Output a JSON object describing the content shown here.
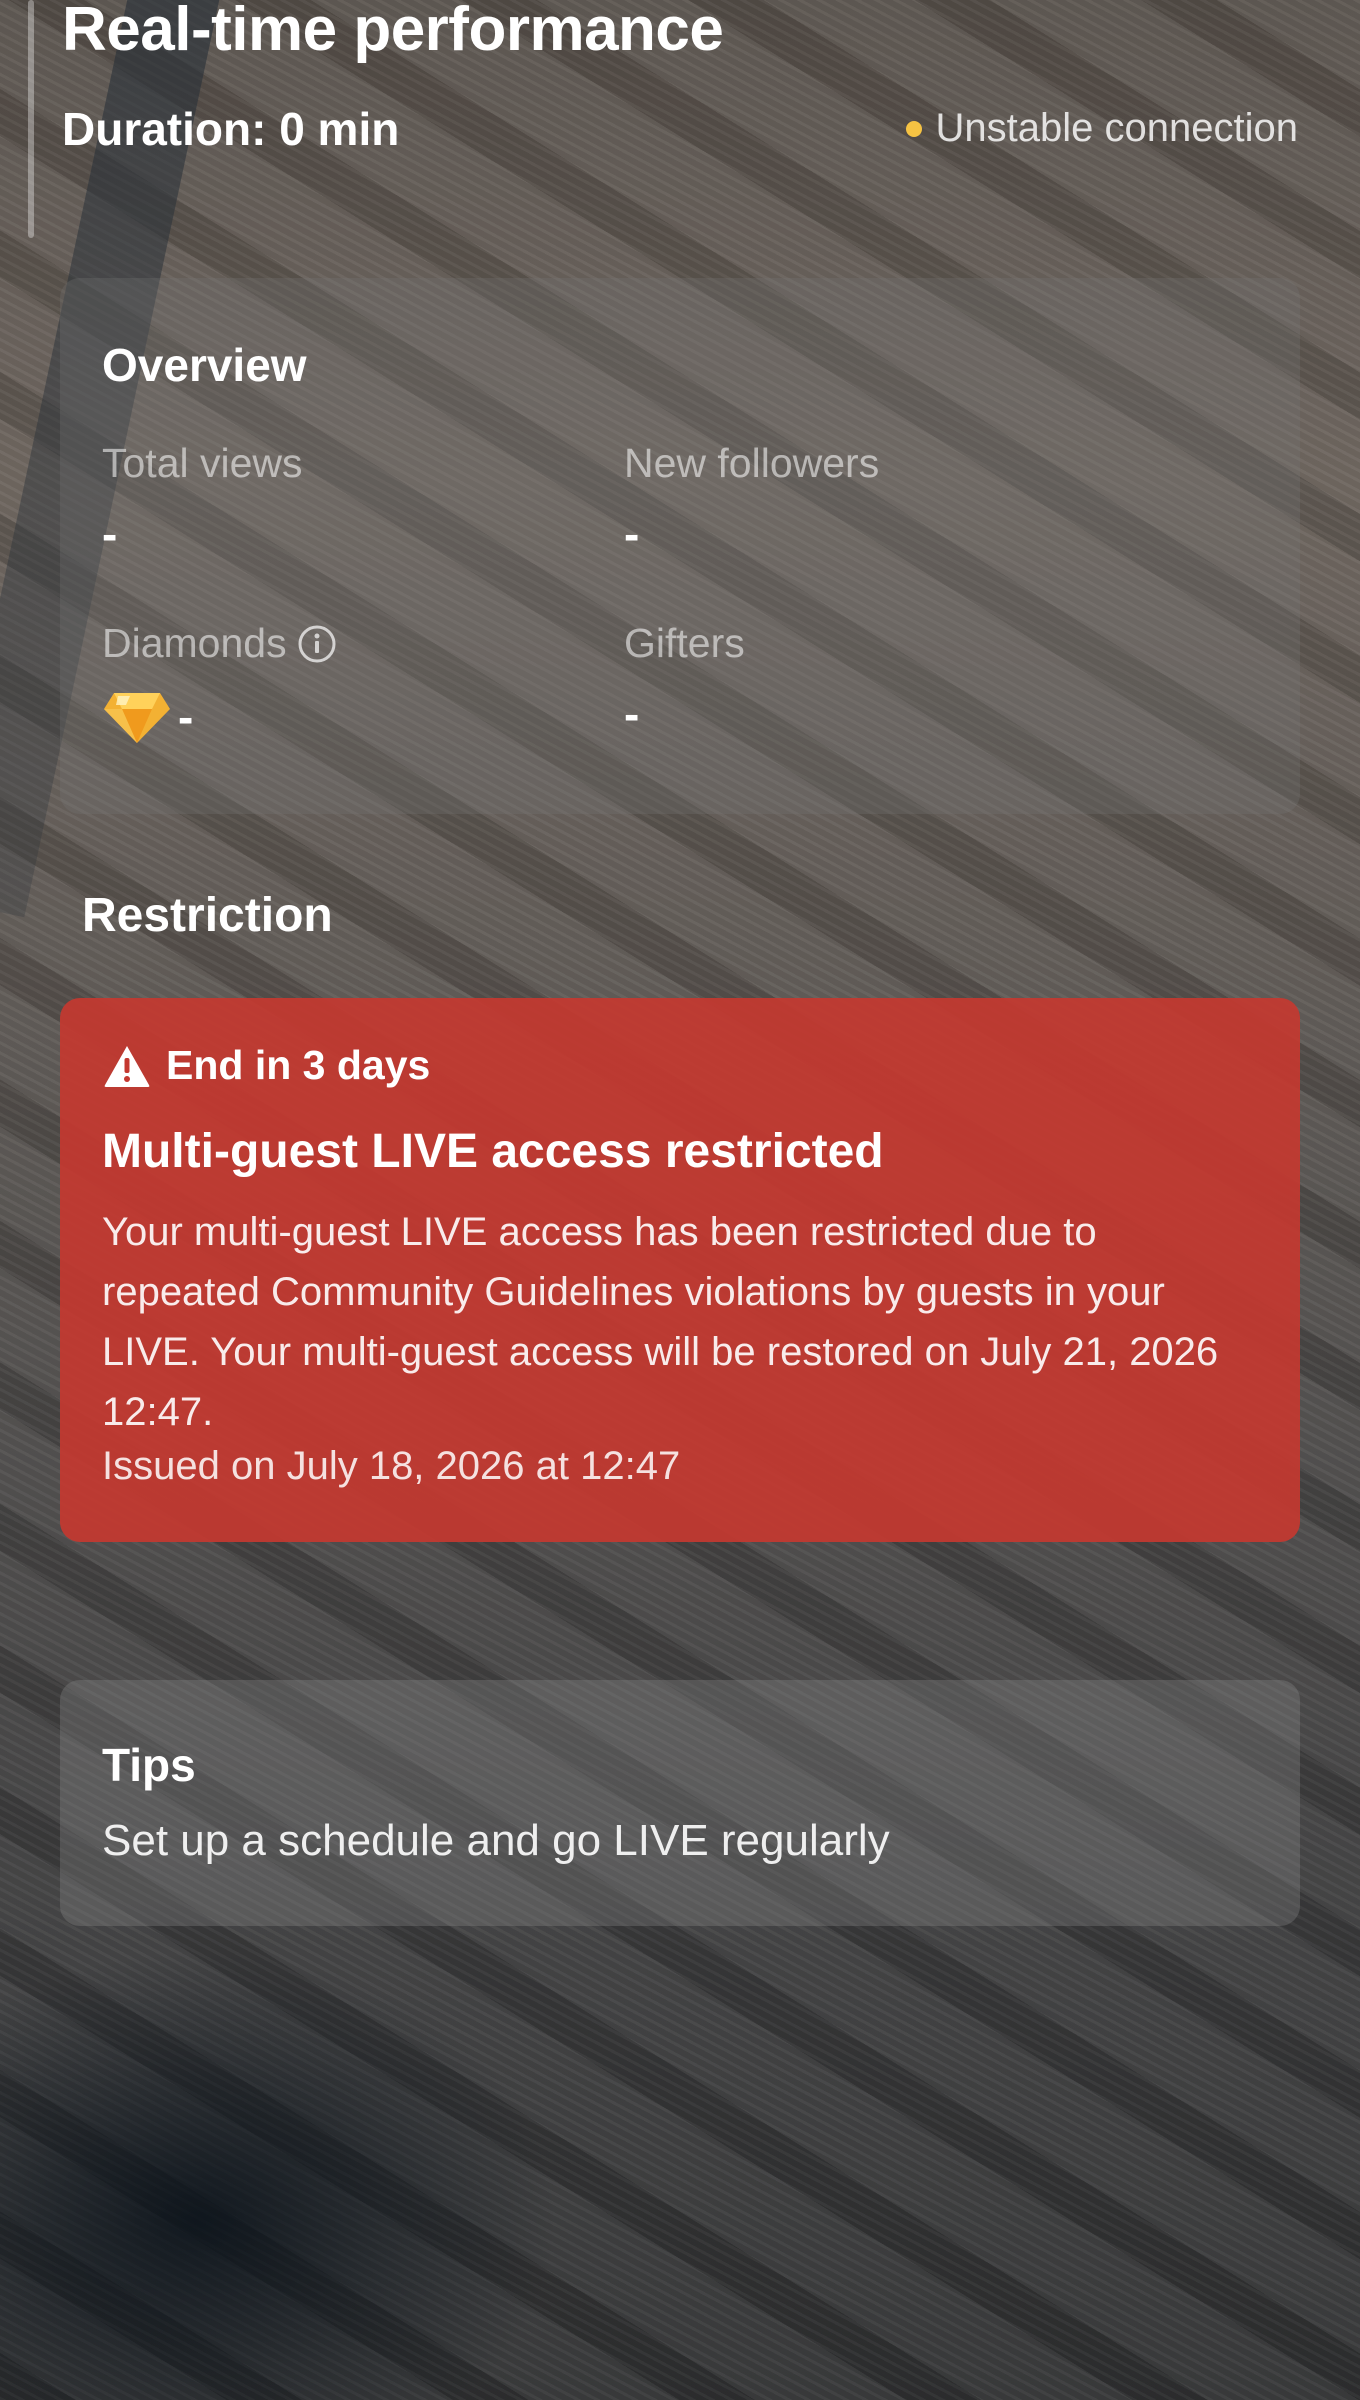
{
  "header": {
    "title": "Real-time performance",
    "duration": "Duration: 0 min",
    "connection_status": "Unstable connection",
    "connection_status_color": "#f6c343"
  },
  "overview": {
    "heading": "Overview",
    "metrics": [
      {
        "label": "Total views",
        "value": "-"
      },
      {
        "label": "New followers",
        "value": "-"
      },
      {
        "label": "Diamonds",
        "value": "-",
        "icon": "diamond-icon",
        "info_icon": "info-icon"
      },
      {
        "label": "Gifters",
        "value": "-"
      }
    ]
  },
  "restriction": {
    "section_title": "Restriction",
    "badge_icon": "warning-icon",
    "badge_text": "End in 3 days",
    "title": "Multi-guest LIVE access restricted",
    "body": "Your multi-guest LIVE access has been restricted due to repeated Community Guidelines violations by guests in your LIVE. Your multi-guest access will be restored on July 21, 2026 12:47.",
    "issued": "Issued on July 18, 2026 at 12:47",
    "card_color": "#c43830"
  },
  "tips": {
    "heading": "Tips",
    "text": "Set up a schedule and go LIVE regularly"
  }
}
